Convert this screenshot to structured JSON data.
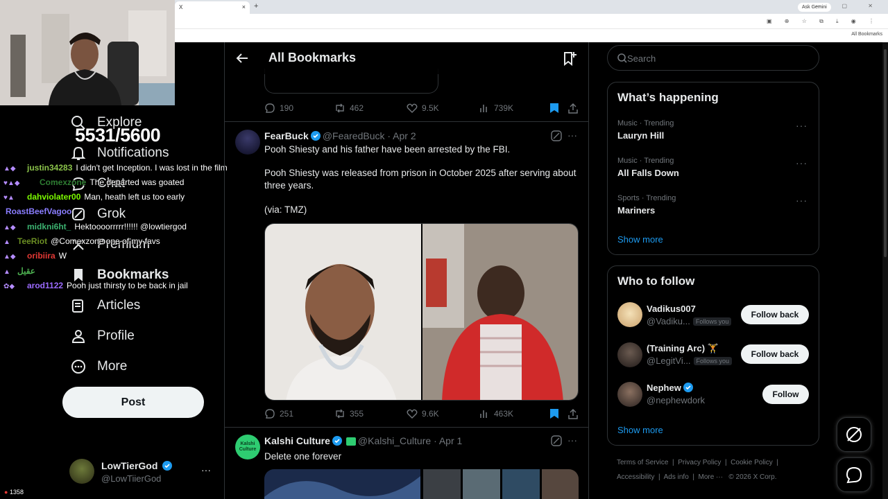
{
  "browser": {
    "tab_title": "X",
    "tab_close": "×",
    "new_tab": "+",
    "ask_gemini": "Ask Gemini",
    "window_controls": "— ▢ ✕",
    "all_bookmarks": "All Bookmarks"
  },
  "overlay": {
    "counter": "5531/5600",
    "viewer_count": "1358",
    "chat": [
      {
        "user": "justin34283",
        "msg": "I didn't get Inception. I was lost in the film",
        "color": "#8bc34a"
      },
      {
        "user": "Comexzone",
        "msg": "The departed was goated",
        "color": "#2e7d32"
      },
      {
        "user": "dahviolater00",
        "msg": "Man, heath left us too early",
        "color": "#7cfc00"
      },
      {
        "user": "RoastBeefVagoo",
        "msg": "",
        "color": "#8a7dff"
      },
      {
        "user": "midkni6ht_",
        "msg": "Hektoooorrrrr!!!!!! @lowtiergod",
        "color": "#3cb371"
      },
      {
        "user": "TeeRiot",
        "msg": "@Comexzone one of my favs",
        "color": "#6b8e23"
      },
      {
        "user": "oribiira",
        "msg": "W",
        "color": "#e53935"
      },
      {
        "user": "عقيل",
        "msg": "",
        "color": "#4caf50"
      },
      {
        "user": "arod1122",
        "msg": "Pooh just thirsty to be back in jail",
        "color": "#9c6bff"
      }
    ]
  },
  "nav": {
    "items": [
      {
        "label": "Explore",
        "icon": "search-icon"
      },
      {
        "label": "Notifications",
        "icon": "bell-icon"
      },
      {
        "label": "Chat",
        "icon": "chat-icon"
      },
      {
        "label": "Grok",
        "icon": "grok-icon"
      },
      {
        "label": "Premium",
        "icon": "x-icon"
      },
      {
        "label": "Bookmarks",
        "icon": "bookmark-icon"
      },
      {
        "label": "Articles",
        "icon": "articles-icon"
      },
      {
        "label": "Profile",
        "icon": "person-icon"
      },
      {
        "label": "More",
        "icon": "more-circle-icon"
      }
    ],
    "post_label": "Post",
    "account": {
      "name": "LowTierGod",
      "handle": "@LowTiierGod"
    }
  },
  "header": {
    "title": "All Bookmarks"
  },
  "tweets": [
    {
      "stats": {
        "replies": "190",
        "reposts": "462",
        "likes": "9.5K",
        "views": "739K"
      }
    },
    {
      "name": "FearBuck",
      "handle": "@FearedBuck",
      "date": "· Apr 2",
      "text1": "Pooh Shiesty and his father have been arrested by the FBI.",
      "text2": "Pooh Shiesty was released from prison in October 2025 after serving about three years.",
      "text3": "(via: TMZ)",
      "stats": {
        "replies": "251",
        "reposts": "355",
        "likes": "9.6K",
        "views": "463K"
      }
    },
    {
      "name": "Kalshi Culture",
      "handle": "@Kalshi_Culture",
      "date": "· Apr 1",
      "text1": "Delete one forever",
      "avatar_text": "Kalshi Culture"
    }
  ],
  "right": {
    "search_placeholder": "Search",
    "happening_title": "What’s happening",
    "trends": [
      {
        "category": "Music · Trending",
        "name": "Lauryn Hill"
      },
      {
        "category": "Music · Trending",
        "name": "All Falls Down"
      },
      {
        "category": "Sports · Trending",
        "name": "Mariners"
      }
    ],
    "show_more": "Show more",
    "wtf_title": "Who to follow",
    "follow": [
      {
        "name": "Vadikus007",
        "handle": "@Vadiku...",
        "follows_you": "Follows you",
        "button": "Follow back"
      },
      {
        "name": "(Training Arc) 🏋",
        "handle": "@LegitVi...",
        "follows_you": "Follows you",
        "button": "Follow back"
      },
      {
        "name": "Nephew",
        "handle": "@nephewdork",
        "follows_you": "",
        "button": "Follow"
      }
    ],
    "footer": {
      "terms": "Terms of Service",
      "privacy": "Privacy Policy",
      "cookie": "Cookie Policy",
      "accessibility": "Accessibility",
      "ads": "Ads info",
      "more": "More ···",
      "copyright": "© 2026 X Corp."
    }
  },
  "colors": {
    "accent": "#1d9bf0",
    "bookmark_active": "#1d9bf0",
    "border": "#2f3336"
  }
}
